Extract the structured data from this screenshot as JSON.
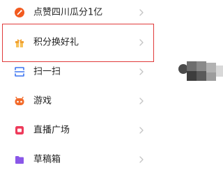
{
  "menu": {
    "items": [
      {
        "label": "点赞四川瓜分1亿",
        "icon": "red-orange-circle-icon"
      },
      {
        "label": "积分换好礼",
        "icon": "gift-icon"
      },
      {
        "label": "扫一扫",
        "icon": "scan-icon"
      },
      {
        "label": "游戏",
        "icon": "game-controller-icon"
      },
      {
        "label": "直播广场",
        "icon": "live-tv-icon"
      },
      {
        "label": "草稿箱",
        "icon": "folder-icon"
      }
    ],
    "highlighted_index": 1
  },
  "colors": {
    "highlight_border": "#e03a3a",
    "icon_orange": "#f25a1f",
    "icon_gift": "#f0a030",
    "icon_scan": "#3b73f0",
    "icon_game": "#f26a2a",
    "icon_live": "#ee3a5a",
    "icon_folder": "#8a57e8"
  }
}
